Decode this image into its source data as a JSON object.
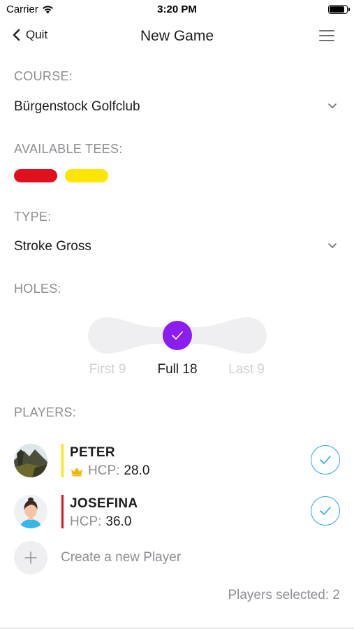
{
  "status_bar": {
    "carrier": "Carrier",
    "time": "3:20 PM",
    "battery_level": 0.9
  },
  "nav": {
    "back_label": "Quit",
    "title": "New Game"
  },
  "course": {
    "label": "COURSE:",
    "value": "Bürgenstock Golfclub"
  },
  "tees": {
    "label": "AVAILABLE TEES:",
    "items": [
      {
        "color": "#e0101e"
      },
      {
        "color": "#ffe600"
      }
    ]
  },
  "type": {
    "label": "TYPE:",
    "value": "Stroke Gross"
  },
  "holes": {
    "label": "HOLES:",
    "options": [
      "First 9",
      "Full 18",
      "Last 9"
    ],
    "selected": "Full 18",
    "accent": "#8b1df0"
  },
  "players": {
    "label": "PLAYERS:",
    "list": [
      {
        "name": "PETER",
        "hcp_label": "HCP:",
        "hcp": "28.0",
        "tee_color": "#ffe600",
        "badge": "crown-icon",
        "selected": true
      },
      {
        "name": "JOSEFINA",
        "hcp_label": "HCP:",
        "hcp": "36.0",
        "tee_color": "#e0101e",
        "selected": true
      }
    ],
    "create_label": "Create a new Player",
    "selected_summary": "Players selected: 2"
  },
  "colors": {
    "check": "#2aa7e0",
    "muted": "#8e8e93",
    "crown": "#f4b400"
  }
}
